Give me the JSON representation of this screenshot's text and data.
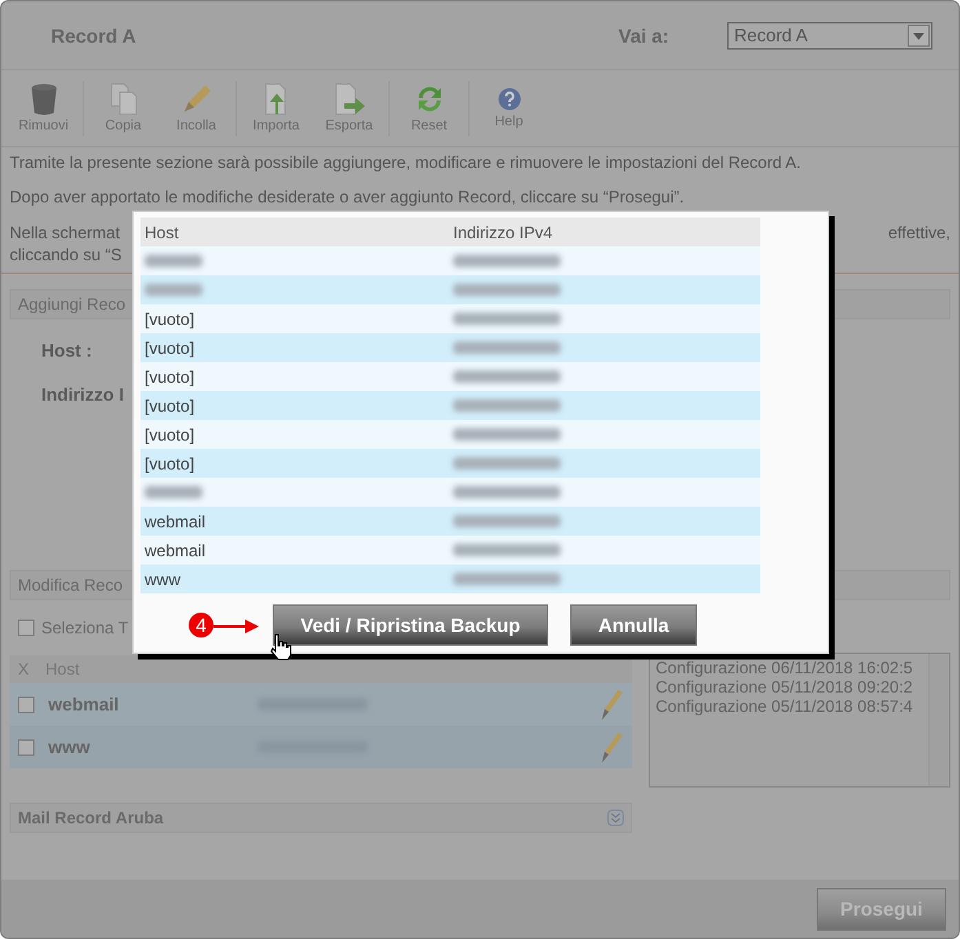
{
  "header": {
    "title": "Record A",
    "goto_label": "Vai a:",
    "goto_value": "Record A"
  },
  "toolbar": [
    {
      "label": "Rimuovi",
      "kind": "trash",
      "group_end": true
    },
    {
      "label": "Copia",
      "kind": "copy",
      "group_end": false
    },
    {
      "label": "Incolla",
      "kind": "pencil",
      "group_end": true
    },
    {
      "label": "Importa",
      "kind": "import",
      "group_end": false
    },
    {
      "label": "Esporta",
      "kind": "export",
      "group_end": true
    },
    {
      "label": "Reset",
      "kind": "reset",
      "group_end": true
    },
    {
      "label": "Help",
      "kind": "help",
      "group_end": false
    }
  ],
  "info": {
    "paragraphs": [
      "Tramite la presente sezione sarà possibile aggiungere, modificare e rimuovere le impostazioni del Record A.",
      "Dopo aver apportato le modifiche desiderate o aver aggiunto Record, cliccare su “Prosegui”."
    ],
    "left_lines": [
      "Nella schermat",
      "cliccando su “S"
    ],
    "right_lines": [
      "effettive,"
    ]
  },
  "add_section": {
    "title": "Aggiungi Reco",
    "fields": [
      "Host :",
      "Indirizzo I"
    ]
  },
  "edit_section": {
    "title": "Modifica Reco",
    "select_all": {
      "label": "Seleziona T",
      "checked": false
    },
    "columns": [
      "X",
      "Host"
    ],
    "rows": [
      {
        "host": "webmail",
        "checked": false,
        "ip_blurred": true
      },
      {
        "host": "www",
        "checked": false,
        "ip_blurred": true
      }
    ]
  },
  "backups": [
    "Configurazione 06/11/2018 16:02:5",
    "Configurazione 05/11/2018 09:20:2",
    "Configurazione 05/11/2018 08:57:4"
  ],
  "mail_section": {
    "title": "Mail Record Aruba"
  },
  "footer": {
    "button": "Prosegui"
  },
  "modal": {
    "columns": [
      "Host",
      "Indirizzo IPv4"
    ],
    "rows": [
      {
        "host_blurred": true,
        "ip_blurred": true
      },
      {
        "host_blurred": true,
        "ip_blurred": true
      },
      {
        "host": "[vuoto]",
        "ip_blurred": true
      },
      {
        "host": "[vuoto]",
        "ip_blurred": true
      },
      {
        "host": "[vuoto]",
        "ip_blurred": true
      },
      {
        "host": "[vuoto]",
        "ip_blurred": true
      },
      {
        "host": "[vuoto]",
        "ip_blurred": true
      },
      {
        "host": "[vuoto]",
        "ip_blurred": true
      },
      {
        "host_blurred": true,
        "ip_blurred": true
      },
      {
        "host": "webmail",
        "ip_blurred": true
      },
      {
        "host": "webmail",
        "ip_blurred": true
      },
      {
        "host": "www",
        "ip_blurred": true
      }
    ],
    "buttons": [
      {
        "label": "Vedi / Ripristina Backup",
        "kind": "primary"
      },
      {
        "label": "Annulla",
        "kind": "secondary"
      }
    ],
    "annotation": "4"
  }
}
